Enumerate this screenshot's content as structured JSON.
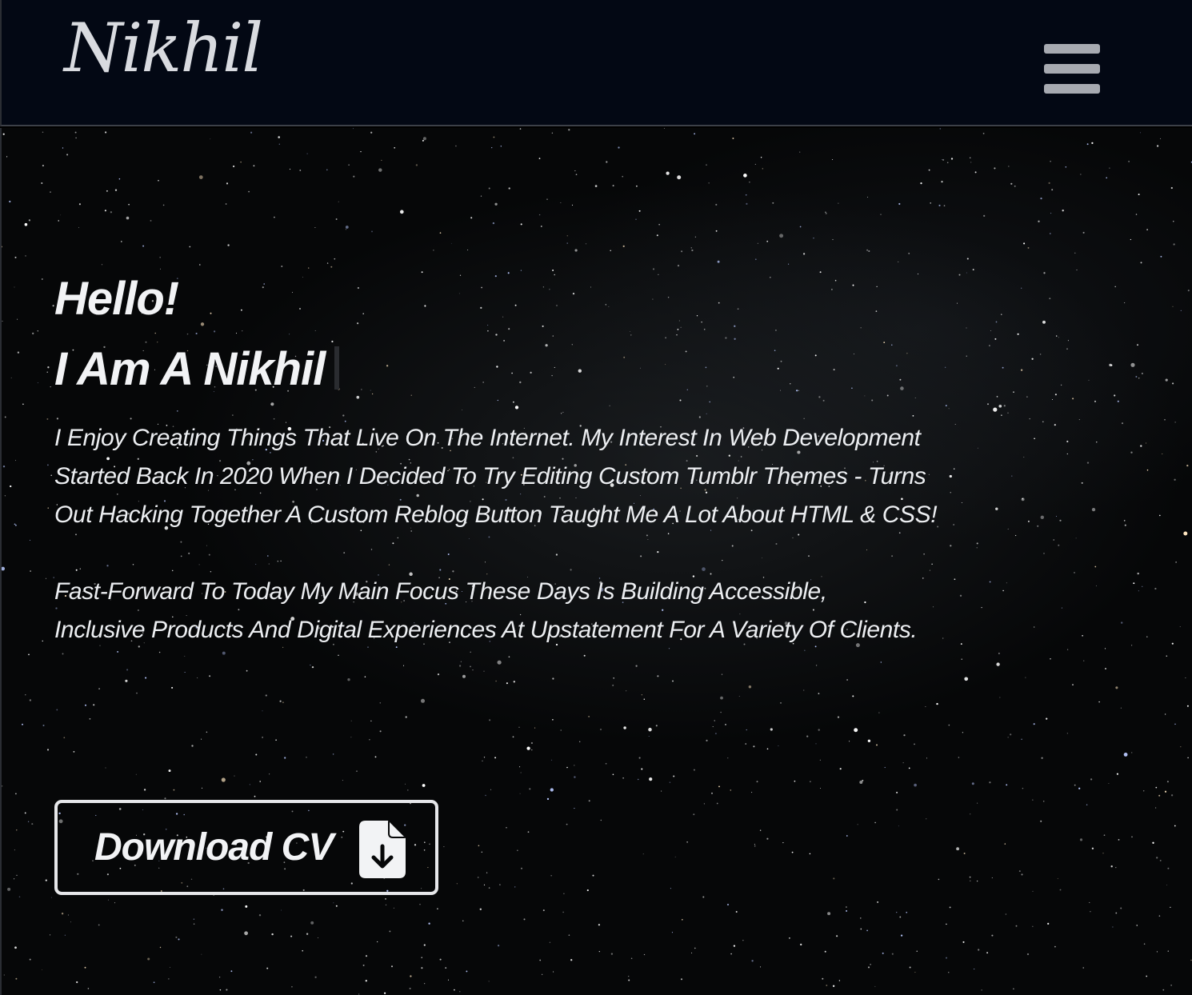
{
  "header": {
    "logo": "Nikhil",
    "menu_icon": "hamburger-menu-icon"
  },
  "hero": {
    "line1": "Hello!",
    "line2": "I Am A Nikhil",
    "paragraph1_lines": [
      "I Enjoy Creating Things That Live On The Internet. My Interest In Web Development",
      "Started Back In 2020 When I Decided To Try Editing Custom Tumblr Themes - Turns",
      "Out Hacking Together A Custom Reblog Button Taught Me A Lot About HTML & CSS!"
    ],
    "paragraph2_lines": [
      "Fast-Forward To Today My Main Focus These Days Is Building Accessible,",
      "Inclusive Products And Digital Experiences At Upstatement For A Variety Of Clients."
    ],
    "cv_button": {
      "label": "Download CV",
      "icon": "file-download-icon"
    }
  },
  "colors": {
    "header_bg": "#030814",
    "hero_bg": "#060708",
    "text": "#f2f3f5",
    "menu_icon": "#a7aab1",
    "button_border": "#e6e7ea"
  }
}
